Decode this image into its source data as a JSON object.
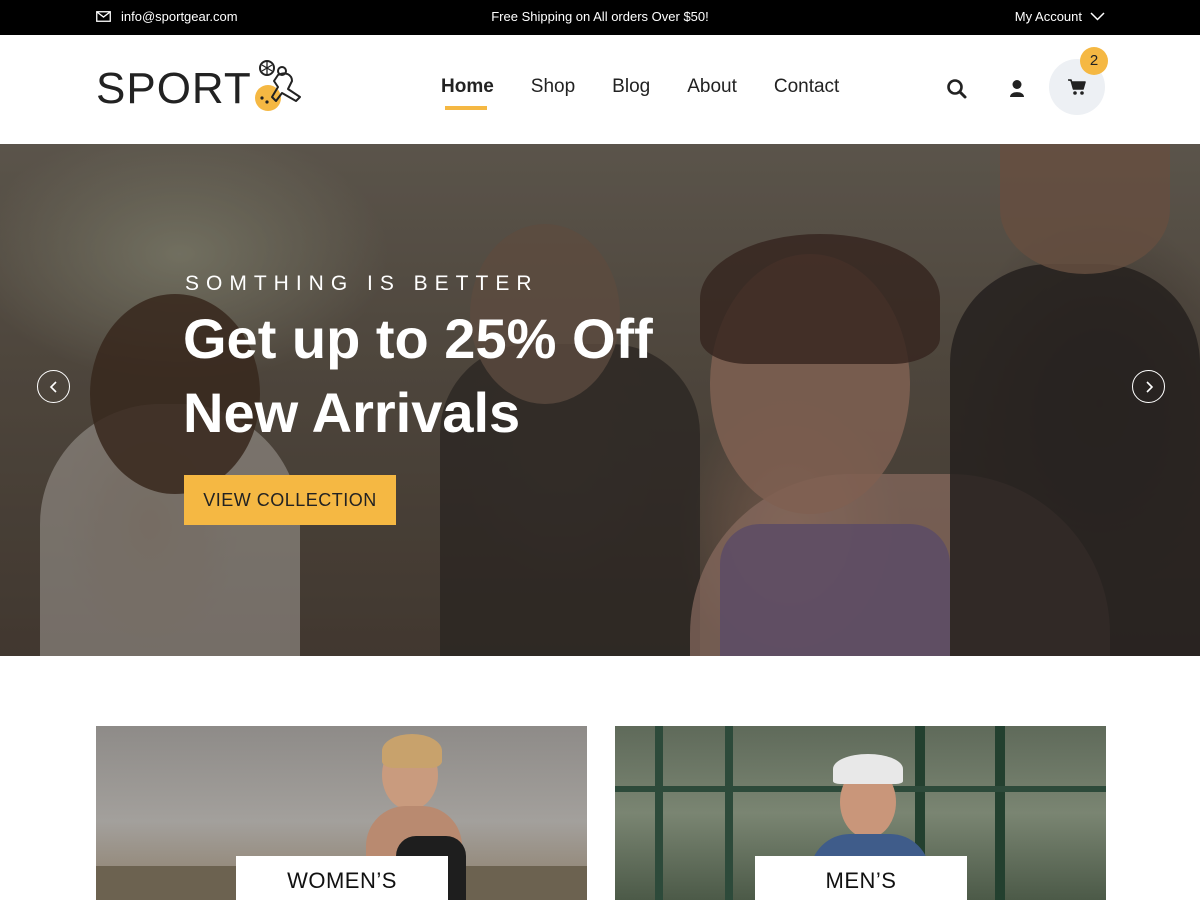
{
  "topbar": {
    "email": "info@sportgear.com",
    "email_icon": "envelope-icon",
    "promo": "Free Shipping on All orders Over $50!",
    "account_label": "My Account",
    "account_icon": "chevron-down-icon"
  },
  "header": {
    "logo_text": "SPORT",
    "nav": [
      {
        "label": "Home",
        "active": true
      },
      {
        "label": "Shop"
      },
      {
        "label": "Blog"
      },
      {
        "label": "About"
      },
      {
        "label": "Contact"
      }
    ],
    "icons": [
      "search-icon",
      "user-icon",
      "cart-icon"
    ],
    "cart_count": "2"
  },
  "hero": {
    "kicker": "SOMTHING IS BETTER",
    "title_line1": "Get up to 25% Off",
    "title_line2": "New Arrivals",
    "button": "VIEW COLLECTION",
    "prev_icon": "chevron-left-icon",
    "next_icon": "chevron-right-icon"
  },
  "categories": [
    {
      "label": "WOMEN’S"
    },
    {
      "label": "MEN’S"
    }
  ],
  "colors": {
    "accent": "#f5b843",
    "topbar_bg": "#000000",
    "cart_bg": "#edf0f4"
  }
}
